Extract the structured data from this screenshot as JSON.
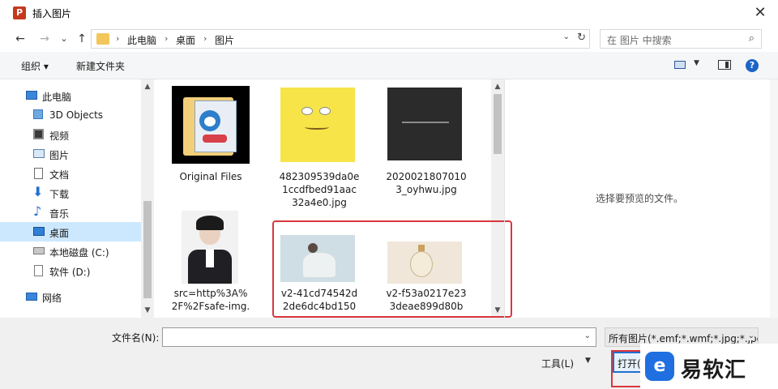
{
  "window": {
    "title": "插入图片",
    "app_icon_letter": "P",
    "close": "✕"
  },
  "address_bar": {
    "back": "←",
    "forward": "→",
    "recent": "⌄",
    "up": "↑",
    "crumbs": [
      "此电脑",
      "桌面",
      "图片"
    ],
    "separator": "›",
    "dropdown": "⌄",
    "refresh": "↻"
  },
  "search": {
    "placeholder": "在 图片 中搜索",
    "icon": "⌕"
  },
  "toolbar": {
    "organize": "组织 ▾",
    "new_folder": "新建文件夹",
    "view_dropdown": "▼",
    "help": "?"
  },
  "nav": {
    "items": [
      {
        "label": "此电脑",
        "icon": "computer-icon"
      },
      {
        "label": "3D Objects",
        "icon": "cube-icon"
      },
      {
        "label": "视频",
        "icon": "video-icon"
      },
      {
        "label": "图片",
        "icon": "picture-icon"
      },
      {
        "label": "文档",
        "icon": "document-icon"
      },
      {
        "label": "下载",
        "icon": "download-icon"
      },
      {
        "label": "音乐",
        "icon": "music-icon"
      },
      {
        "label": "桌面",
        "icon": "desktop-icon",
        "selected": true
      },
      {
        "label": "本地磁盘 (C:)",
        "icon": "drive-icon"
      },
      {
        "label": "软件 (D:)",
        "icon": "drive-icon"
      },
      {
        "label": "网络",
        "icon": "network-icon"
      }
    ],
    "scroll_up": "▲",
    "scroll_down": "▼"
  },
  "files": [
    {
      "name": "Original Files",
      "kind": "folder"
    },
    {
      "name": "482309539da0e1ccdfbed91aac32a4e0.jpg",
      "kind": "image"
    },
    {
      "name": "20200218070103_oyhwu.jpg",
      "kind": "image"
    },
    {
      "name": "src=http%3A%2F%2Fsafe-img.",
      "kind": "image"
    },
    {
      "name": "v2-41cd74542d2de6dc4bd150",
      "kind": "image"
    },
    {
      "name": "v2-f53a0217e233deae899d80b",
      "kind": "image"
    }
  ],
  "file_lines": [
    [
      "Original Files"
    ],
    [
      "482309539da0e",
      "1ccdfbed91aac",
      "32a4e0.jpg"
    ],
    [
      "2020021807010",
      "3_oyhwu.jpg"
    ],
    [
      "src=http%3A%",
      "2F%2Fsafe-img."
    ],
    [
      "v2-41cd74542d",
      "2de6dc4bd150"
    ],
    [
      "v2-f53a0217e23",
      "3deae899d80b"
    ]
  ],
  "preview": {
    "message": "选择要预览的文件。"
  },
  "bottom": {
    "filename_label": "文件名(N):",
    "filename_value": "",
    "filter": "所有图片(*.emf;*.wmf;*.jpg;*.jpeg;*.jfif;*.jpe;*.png)",
    "tools": "工具(L)",
    "tools_dd": "▼",
    "open": "打开("
  },
  "watermark": {
    "logo": "e",
    "text": "易软汇"
  },
  "colors": {
    "accent": "#1e6fd0",
    "highlight": "#d9363e",
    "selection": "#cce8ff"
  }
}
